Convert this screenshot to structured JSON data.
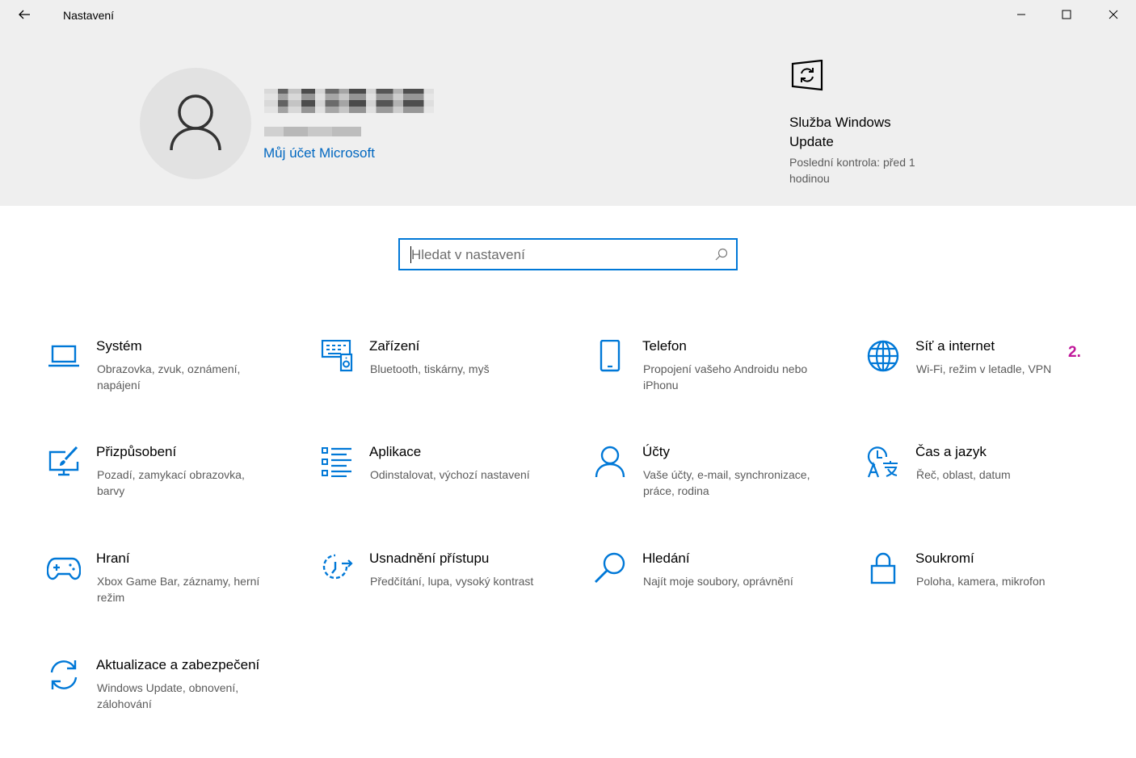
{
  "window": {
    "title": "Nastavení",
    "back_icon": "arrow-left-icon",
    "min_icon": "minimize-icon",
    "max_icon": "maximize-icon",
    "close_icon": "close-icon"
  },
  "header": {
    "ms_account_link": "Můj účet Microsoft",
    "windows_update": {
      "title": "Služba Windows Update",
      "subtitle": "Poslední kontrola: před 1 hodinou"
    }
  },
  "search": {
    "placeholder": "Hledat v nastavení",
    "value": ""
  },
  "marker_label": "2.",
  "colors": {
    "accent": "#0078d7",
    "link": "#0067c0",
    "marker": "#c0179a",
    "banner_bg": "#efefef"
  },
  "tiles": [
    {
      "title": "Systém",
      "desc": "Obrazovka, zvuk, oznámení, napájení",
      "icon": "laptop-icon"
    },
    {
      "title": "Zařízení",
      "desc": "Bluetooth, tiskárny, myš",
      "icon": "devices-icon"
    },
    {
      "title": "Telefon",
      "desc": "Propojení vašeho Androidu nebo iPhonu",
      "icon": "phone-icon"
    },
    {
      "title": "Síť a internet",
      "desc": "Wi-Fi, režim v letadle, VPN",
      "icon": "globe-icon"
    },
    {
      "title": "Přizpůsobení",
      "desc": "Pozadí, zamykací obrazovka, barvy",
      "icon": "personalization-icon"
    },
    {
      "title": "Aplikace",
      "desc": "Odinstalovat, výchozí nastavení",
      "icon": "apps-list-icon"
    },
    {
      "title": "Účty",
      "desc": "Vaše účty, e-mail, synchronizace, práce, rodina",
      "icon": "person-icon"
    },
    {
      "title": "Čas a jazyk",
      "desc": "Řeč, oblast, datum",
      "icon": "time-language-icon"
    },
    {
      "title": "Hraní",
      "desc": "Xbox Game Bar, záznamy, herní režim",
      "icon": "gamepad-icon"
    },
    {
      "title": "Usnadnění přístupu",
      "desc": "Předčítání, lupa, vysoký kontrast",
      "icon": "ease-of-access-icon"
    },
    {
      "title": "Hledání",
      "desc": "Najít moje soubory, oprávnění",
      "icon": "search-magnifier-icon"
    },
    {
      "title": "Soukromí",
      "desc": "Poloha, kamera, mikrofon",
      "icon": "lock-icon"
    },
    {
      "title": "Aktualizace a zabezpečení",
      "desc": "Windows Update, obnovení, zálohování",
      "icon": "sync-icon"
    }
  ]
}
